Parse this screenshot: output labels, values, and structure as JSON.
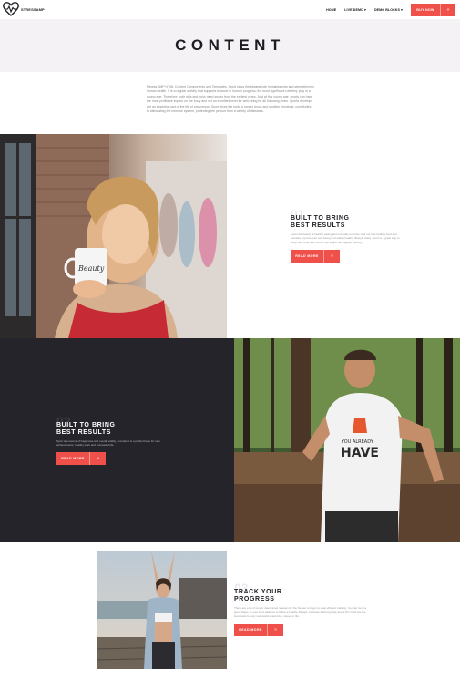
{
  "header": {
    "logo_text": "STRESSAMP",
    "nav": [
      {
        "label": "HOME"
      },
      {
        "label": "LIVE DEMO ▾"
      },
      {
        "label": "DEMO BLOCKS ▾"
      }
    ],
    "buy_label": "BUY NOW",
    "buy_arrow": "»"
  },
  "banner": {
    "title": "CONTENT"
  },
  "intro": {
    "text": "Fitness AMP HTML Content Components and Templates. Sport plays the biggest role in maintaining and strengthening human health. It is a regular activity that supports balance in human progress, the most significant role they play in a young age. Therefore, both girls and boys need sports from the earliest years. Just at this young age, sports can have the most profitable impact on the body and set an excellent level for well-being for all following years. Sports develops are an essential part of the life of any person. Sport gives the body a proper tonus and positive emotions, contributes to stimulating the immune system, protecting the person from a variety of diseases."
  },
  "sections": [
    {
      "number": "01",
      "title_line1": "BUILT TO BRING",
      "title_line2": "BEST RESULTS",
      "text": "Learn the basics of healthy eating and everyday exercise: find out how healthy food and exercise improve your well-being and start a healthy lifestyle today. Sport is a great way to keep your body and mind in top shape with regular training.",
      "button": "READ MORE",
      "arrow": "»"
    },
    {
      "number": "02",
      "title_line1": "BUILT TO BRING",
      "title_line2": "BEST RESULTS",
      "text": "Sport is a source of happiness and overall vitality, and also it is a perfect base for new achievements, healthy work and successful life.",
      "button": "READ MORE",
      "arrow": "»"
    },
    {
      "number": "03",
      "title_line1": "TRACK YOUR",
      "title_line2": "PROGRESS",
      "text": "There are a lot of proper determined reasons for the human to begin to seek efficient training. You can be in a good shape, in your best patience to follow a healthy lifestyle, because a strong body and a firm mind are the best basis for any successful enterprise, career or life.",
      "button": "READ MORE",
      "arrow": "»"
    }
  ],
  "colors": {
    "accent": "#f0504a",
    "dark": "#26242b",
    "banner_bg": "#f4f2f5"
  }
}
